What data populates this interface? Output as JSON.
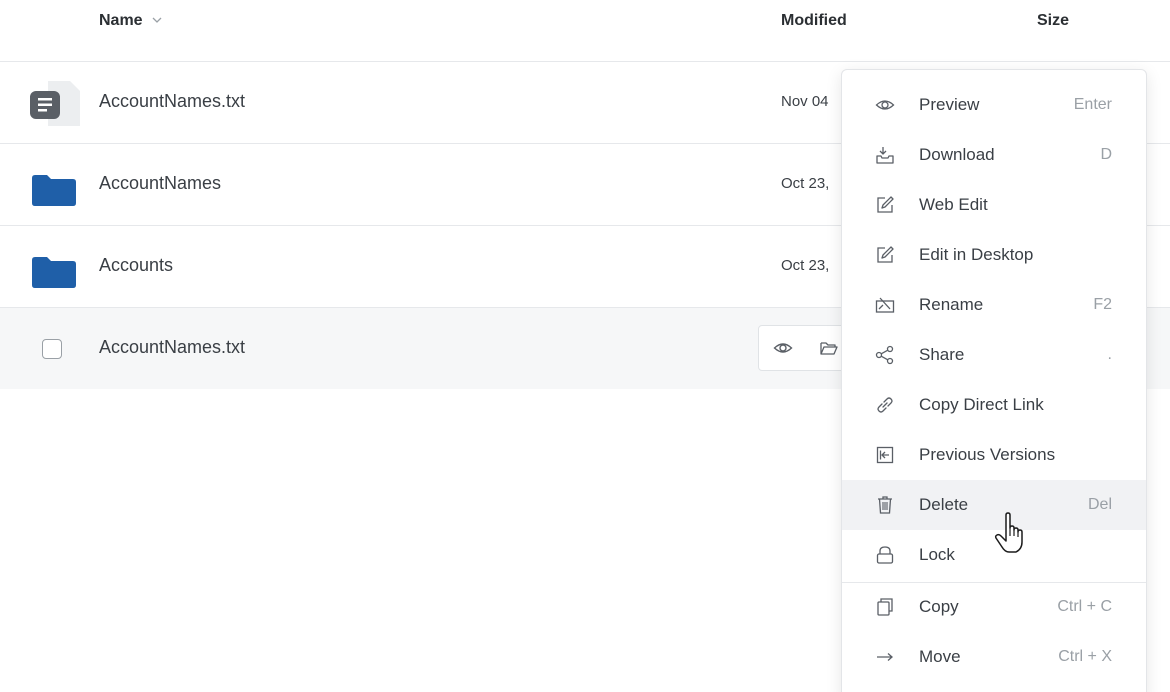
{
  "header": {
    "name_label": "Name",
    "name_sort_icon": "chevron-down-icon",
    "modified_label": "Modified",
    "size_label": "Size"
  },
  "rows": [
    {
      "name": "AccountNames.txt",
      "date": "Nov 04",
      "icon": "text-file-icon"
    },
    {
      "name": "AccountNames",
      "date": "Oct 23,",
      "icon": "folder-icon"
    },
    {
      "name": "Accounts",
      "date": "Oct 23,",
      "icon": "folder-icon"
    },
    {
      "name": "AccountNames.txt",
      "icon": "checkbox",
      "quick_actions": [
        "eye-icon",
        "folder-open-icon"
      ]
    }
  ],
  "context_menu": {
    "items": [
      {
        "label": "Preview",
        "shortcut": "Enter",
        "icon": "eye-icon"
      },
      {
        "label": "Download",
        "shortcut": "D",
        "icon": "download-icon"
      },
      {
        "label": "Web Edit",
        "shortcut": "",
        "icon": "edit-icon"
      },
      {
        "label": "Edit in Desktop",
        "shortcut": "",
        "icon": "edit-icon"
      },
      {
        "label": "Rename",
        "shortcut": "F2",
        "icon": "rename-icon"
      },
      {
        "label": "Share",
        "shortcut": ".",
        "icon": "share-icon"
      },
      {
        "label": "Copy Direct Link",
        "shortcut": "",
        "icon": "link-icon"
      },
      {
        "label": "Previous Versions",
        "shortcut": "",
        "icon": "versions-icon"
      },
      {
        "label": "Delete",
        "shortcut": "Del",
        "icon": "trash-icon",
        "highlighted": true
      },
      {
        "label": "Lock",
        "shortcut": "",
        "icon": "lock-icon"
      },
      {
        "label": "Copy",
        "shortcut": "Ctrl + C",
        "icon": "copy-icon"
      },
      {
        "label": "Move",
        "shortcut": "Ctrl + X",
        "icon": "arrow-right-icon"
      }
    ]
  },
  "colors": {
    "folder": "#1f5fa8",
    "doc": "#5a5f66",
    "highlight": "#f1f2f4",
    "muted": "#9aa0a6"
  }
}
